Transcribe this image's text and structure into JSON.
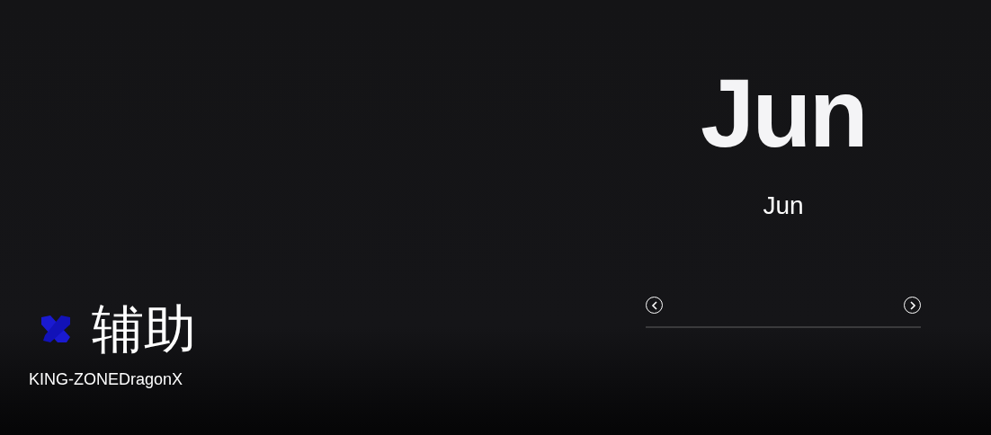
{
  "player": {
    "role": "辅助",
    "team": "KING-ZONEDragonX"
  },
  "hero": {
    "name": "Jun",
    "subtitle": "Jun"
  }
}
